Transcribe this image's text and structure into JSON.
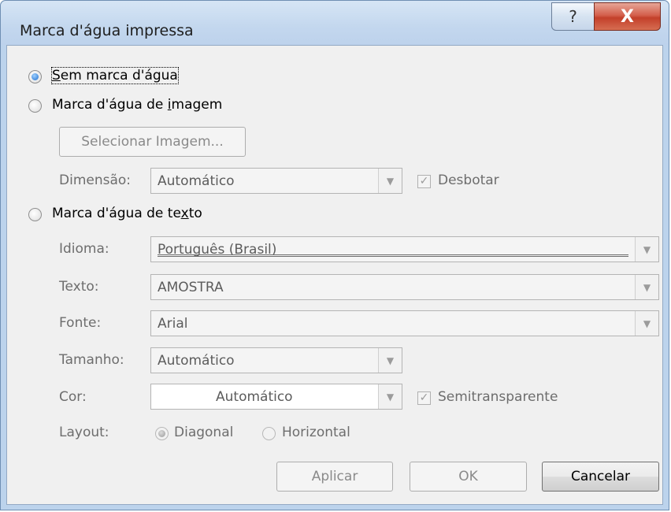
{
  "window": {
    "title": "Marca d'água impressa",
    "help_glyph": "?",
    "close_glyph": "X"
  },
  "options": {
    "no_watermark": {
      "label_prefix": "",
      "label_accel": "S",
      "label_rest": "em marca d'água",
      "selected": true
    },
    "picture_watermark": {
      "label_prefix": "Marca d'água de ",
      "label_accel": "i",
      "label_rest": "magem",
      "selected": false
    },
    "text_watermark": {
      "label_prefix": "Marca d'água de te",
      "label_accel": "x",
      "label_rest": "to",
      "selected": false
    }
  },
  "picture": {
    "select_button": "Selecionar Imagem...",
    "scale_label": "Dimensão:",
    "scale_value": "Automático",
    "washout_label": "Desbotar",
    "washout_checked": true
  },
  "text": {
    "language_label": "Idioma:",
    "language_value": "Português (Brasil)",
    "text_label": "Texto:",
    "text_value": "AMOSTRA",
    "font_label": "Fonte:",
    "font_value": "Arial",
    "size_label": "Tamanho:",
    "size_value": "Automático",
    "color_label": "Cor:",
    "color_value": "Automático",
    "semitransparent_label": "Semitransparente",
    "semitransparent_checked": true,
    "layout_label": "Layout:",
    "layout_diagonal": "Diagonal",
    "layout_horizontal": "Horizontal",
    "layout_selected": "Diagonal"
  },
  "buttons": {
    "apply": "Aplicar",
    "ok": "OK",
    "cancel": "Cancelar"
  },
  "icons": {
    "dropdown": "chevron-down-icon",
    "check": "check-icon"
  },
  "colors": {
    "frame": "#bcd3ec",
    "client": "#f0f0f0",
    "close_red": "#c3402a"
  }
}
